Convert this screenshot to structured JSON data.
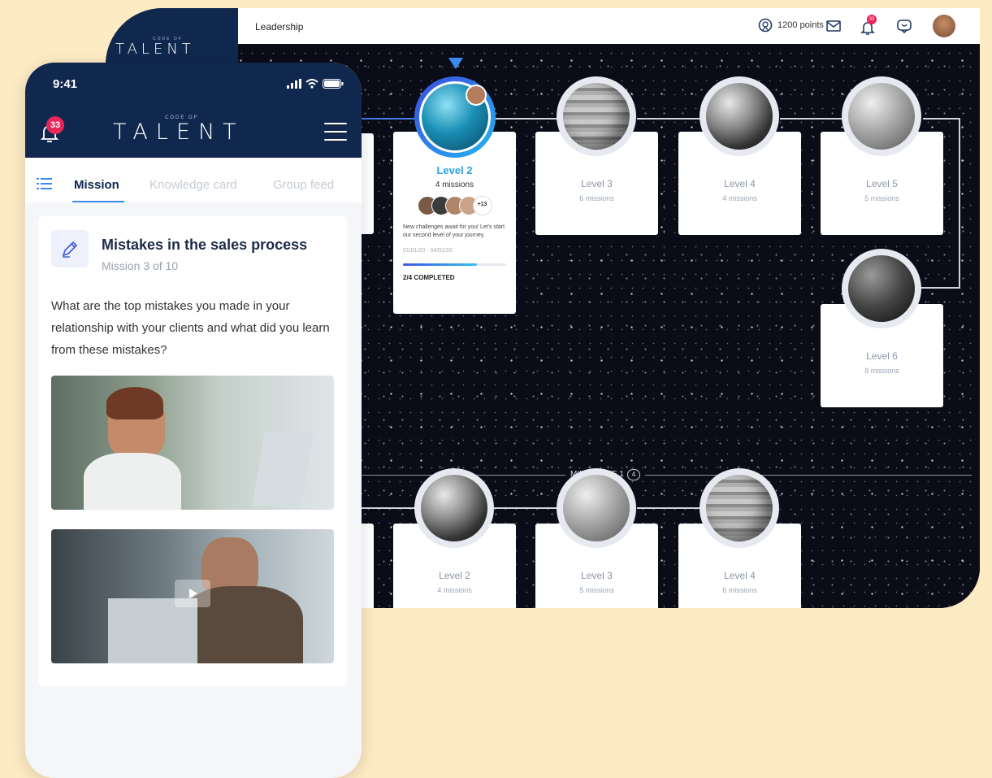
{
  "desktop": {
    "logo": {
      "small": "CODE OF",
      "big": "TALENT"
    },
    "topbar": {
      "title": "Leadership",
      "points": "1200 points",
      "notifications_badge": "33"
    },
    "levels_row1": [
      {
        "label": "Level 3",
        "missions": "6 missions"
      },
      {
        "label": "Level 4",
        "missions": "4 missions"
      },
      {
        "label": "Level 5",
        "missions": "5 missions"
      },
      {
        "label": "Level 6",
        "missions": "8 missions"
      }
    ],
    "active_level": {
      "label": "Level 2",
      "missions": "4 missions",
      "avatars_more": "+13",
      "text": "New challenges await for you! Let's start our second level of your journey.",
      "dates": "01/01/20 - 04/01/20",
      "progress": 0.72,
      "completed": "2/4 COMPLETED"
    },
    "milestone": {
      "label": "MILESTONE 1",
      "count": "4"
    },
    "levels_row2": [
      {
        "label": "Level 2",
        "missions": "4 missions"
      },
      {
        "label": "Level 3",
        "missions": "5 missions"
      },
      {
        "label": "Level 4",
        "missions": "6 missions"
      }
    ]
  },
  "phone": {
    "time": "9:41",
    "notifications_badge": "33",
    "logo": {
      "small": "CODE OF",
      "big": "TALENT"
    },
    "tabs": [
      "Mission",
      "Knowledge card",
      "Group feed"
    ],
    "mission": {
      "title": "Mistakes in the sales process",
      "subtitle": "Mission 3 of 10",
      "question": "What are the top mistakes you made in your relationship with your clients and what did you learn from these mistakes?"
    }
  }
}
